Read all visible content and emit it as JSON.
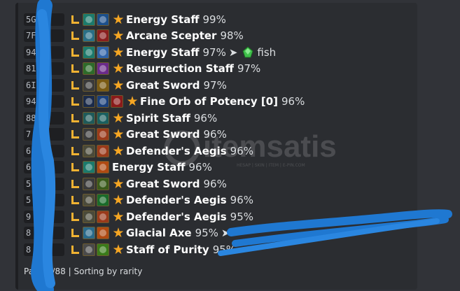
{
  "embed": {
    "accent_color": "#1e1f22",
    "watermark": {
      "brand": "itemsatis",
      "tagline": "HESAP | SKIN | ITEM | E-PIN.COM"
    },
    "rows": [
      {
        "id": "5GN",
        "icons": [
          "energy-staff-item-icon",
          "energy-orb-icon"
        ],
        "star": true,
        "name": "Energy Staff",
        "quality": "99%",
        "color1": "#1c7a6c",
        "color2": "#1c4f8a"
      },
      {
        "id": "7F",
        "icons": [
          "arcane-scepter-item-icon",
          "arcane-swirl-icon"
        ],
        "star": true,
        "name": "Arcane Scepter",
        "quality": "98%",
        "color1": "#2a6f86",
        "color2": "#8a1f1f"
      },
      {
        "id": "94",
        "icons": [
          "energy-staff-item-icon",
          "lightning-icon"
        ],
        "star": true,
        "name": "Energy Staff",
        "quality": "97%",
        "arrow": "➤",
        "extra_icon": "green-gem-icon",
        "extra": "fish",
        "color1": "#1c7a6c",
        "color2": "#2f63a8"
      },
      {
        "id": "81",
        "icons": [
          "resurrection-staff-item-icon",
          "purple-hand-icon"
        ],
        "star": true,
        "name": "Resurrection Staff",
        "quality": "97%",
        "color1": "#2d6b2a",
        "color2": "#6a2a8a"
      },
      {
        "id": "6I",
        "icons": [
          "great-sword-item-icon",
          "gold-slash-icon"
        ],
        "star": true,
        "name": "Great Sword",
        "quality": "97%",
        "color1": "#3a3a3a",
        "color2": "#7a5a12"
      },
      {
        "id": "94",
        "icons": [
          "fine-orb-item-icon",
          "blue-orb-icon",
          "red-rune-icon"
        ],
        "star": true,
        "name": "Fine Orb of Potency [0]",
        "quality": "96%",
        "color1": "#1a2a4a",
        "color2": "#1a3f7a",
        "color3": "#8a1a1a"
      },
      {
        "id": "88",
        "icons": [
          "spirit-staff-item-icon",
          "spirit-icon"
        ],
        "star": true,
        "name": "Spirit Staff",
        "quality": "96%",
        "color1": "#1f5a5a",
        "color2": "#1a5f5f"
      },
      {
        "id": "7",
        "icons": [
          "great-sword-item-icon",
          "red-fist-icon"
        ],
        "star": true,
        "name": "Great Sword",
        "quality": "96%",
        "color1": "#3a3a3a",
        "color2": "#9a3a1a"
      },
      {
        "id": "6",
        "icons": [
          "defenders-aegis-item-icon",
          "red-fist-icon"
        ],
        "star": true,
        "name": "Defender's Aegis",
        "quality": "96%",
        "color1": "#4a4a3a",
        "color2": "#9a3a1a"
      },
      {
        "id": "6",
        "icons": [
          "energy-staff-item-icon",
          "fire-icon"
        ],
        "star": false,
        "name": "Energy Staff",
        "quality": "96%",
        "color1": "#1c7a6c",
        "color2": "#b04a12"
      },
      {
        "id": "5",
        "icons": [
          "great-sword-item-icon",
          "green-emblem-icon"
        ],
        "star": true,
        "name": "Great Sword",
        "quality": "96%",
        "color1": "#3a3a3a",
        "color2": "#3a5a1a"
      },
      {
        "id": "5",
        "icons": [
          "defenders-aegis-item-icon",
          "green-glow-icon"
        ],
        "star": true,
        "name": "Defender's Aegis",
        "quality": "96%",
        "color1": "#4a4a3a",
        "color2": "#1a6a2a"
      },
      {
        "id": "9",
        "icons": [
          "defenders-aegis-item-icon",
          "red-fist-icon"
        ],
        "star": true,
        "name": "Defender's Aegis",
        "quality": "95%",
        "color1": "#4a4a3a",
        "color2": "#9a3a1a"
      },
      {
        "id": "8",
        "icons": [
          "glacial-axe-item-icon",
          "fire-burst-icon"
        ],
        "star": true,
        "name": "Glacial Axe",
        "quality": "95%",
        "arrow": "➤",
        "color1": "#2a6a8a",
        "color2": "#b04a12"
      },
      {
        "id": "8",
        "icons": [
          "staff-of-purity-item-icon",
          "green-burst-icon"
        ],
        "star": true,
        "name": "Staff of Purity",
        "quality": "95%",
        "color1": "#4a4a4a",
        "color2": "#3a7a1a"
      }
    ],
    "footer": "Page 1/88 | Sorting by rarity"
  }
}
